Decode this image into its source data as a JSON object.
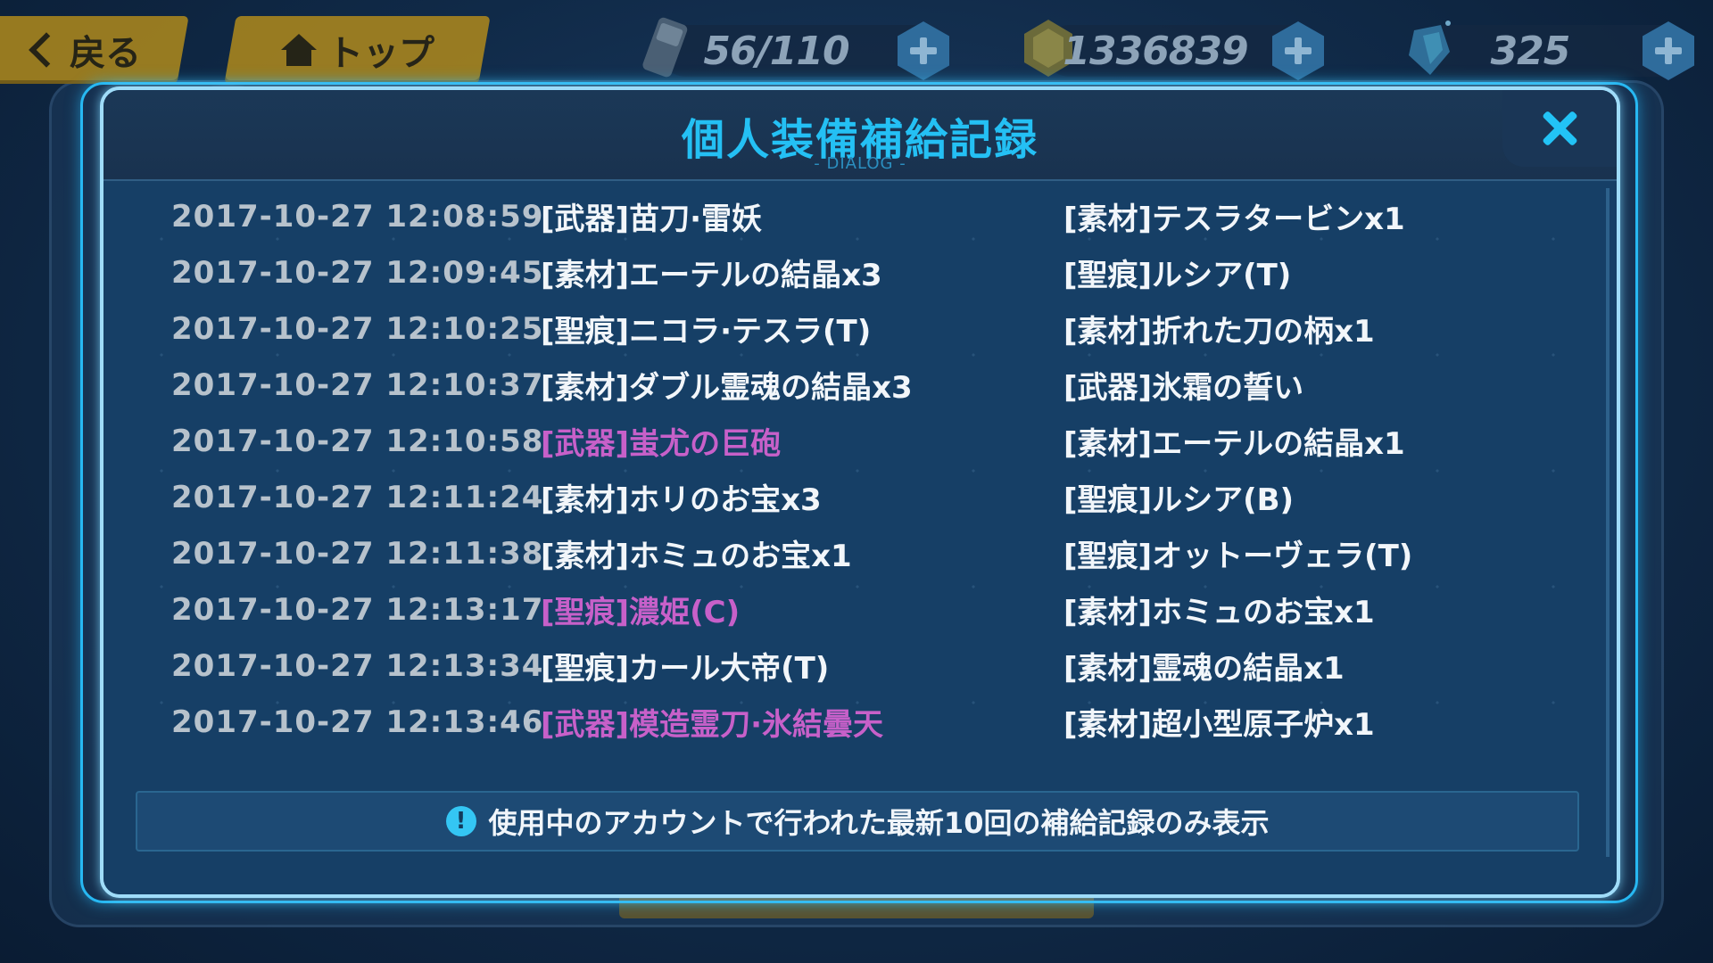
{
  "topbar": {
    "back_label": "戻る",
    "top_label": "トップ",
    "stamina": "56/110",
    "coins": "1336839",
    "crystals": "325"
  },
  "dialog": {
    "title": "個人装備補給記録",
    "subtitle": "- DIALOG -",
    "records": [
      {
        "time": "2017-10-27 12:08:59",
        "item1": "[武器]苗刀·雷妖",
        "item1_rare": false,
        "item2": "[素材]テスラタービンx1"
      },
      {
        "time": "2017-10-27 12:09:45",
        "item1": "[素材]エーテルの結晶x3",
        "item1_rare": false,
        "item2": "[聖痕]ルシア(T)"
      },
      {
        "time": "2017-10-27 12:10:25",
        "item1": "[聖痕]ニコラ·テスラ(T)",
        "item1_rare": false,
        "item2": "[素材]折れた刀の柄x1"
      },
      {
        "time": "2017-10-27 12:10:37",
        "item1": "[素材]ダブル霊魂の結晶x3",
        "item1_rare": false,
        "item2": "[武器]氷霜の誓い"
      },
      {
        "time": "2017-10-27 12:10:58",
        "item1": "[武器]蚩尤の巨砲",
        "item1_rare": true,
        "item2": "[素材]エーテルの結晶x1"
      },
      {
        "time": "2017-10-27 12:11:24",
        "item1": "[素材]ホリのお宝x3",
        "item1_rare": false,
        "item2": "[聖痕]ルシア(B)"
      },
      {
        "time": "2017-10-27 12:11:38",
        "item1": "[素材]ホミュのお宝x1",
        "item1_rare": false,
        "item2": "[聖痕]オットーヴェラ(T)"
      },
      {
        "time": "2017-10-27 12:13:17",
        "item1": "[聖痕]濃姫(C)",
        "item1_rare": true,
        "item2": "[素材]ホミュのお宝x1"
      },
      {
        "time": "2017-10-27 12:13:34",
        "item1": "[聖痕]カール大帝(T)",
        "item1_rare": false,
        "item2": "[素材]霊魂の結晶x1"
      },
      {
        "time": "2017-10-27 12:13:46",
        "item1": "[武器]模造霊刀·氷結曇天",
        "item1_rare": true,
        "item2": "[素材]超小型原子炉x1"
      }
    ],
    "notice": "使用中のアカウントで行われた最新10回の補給記録のみ表示"
  },
  "colors": {
    "accent": "#24c0f4",
    "rare_item": "#c760c9",
    "gold_button": "#b08a1c"
  }
}
